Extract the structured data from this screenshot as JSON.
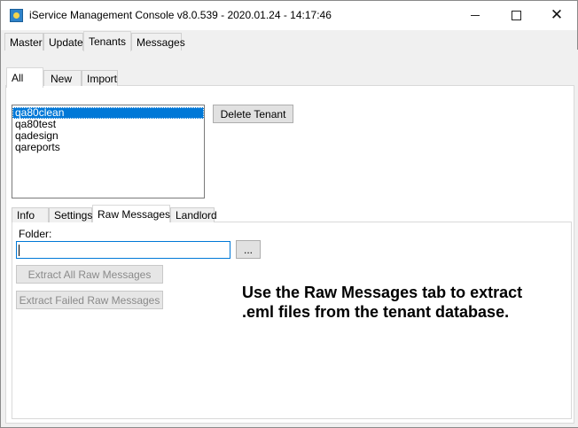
{
  "window": {
    "title": "iService Management Console v8.0.539 - 2020.01.24 - 14:17:46"
  },
  "main_tabs": [
    {
      "label": "Master"
    },
    {
      "label": "Update"
    },
    {
      "label": "Tenants"
    },
    {
      "label": "Messages"
    }
  ],
  "tenant_tabs": [
    {
      "label": "All"
    },
    {
      "label": "New"
    },
    {
      "label": "Import"
    }
  ],
  "tenants": {
    "items": [
      {
        "label": "qa80clean"
      },
      {
        "label": "qa80test"
      },
      {
        "label": "qadesign"
      },
      {
        "label": "qareports"
      }
    ],
    "selected_index": 0,
    "delete_label": "Delete Tenant"
  },
  "detail_tabs": [
    {
      "label": "Info"
    },
    {
      "label": "Settings"
    },
    {
      "label": "Raw Messages"
    },
    {
      "label": "Landlord"
    }
  ],
  "raw_messages": {
    "folder_label": "Folder:",
    "folder_value": "",
    "browse_label": "...",
    "extract_all_label": "Extract All Raw Messages",
    "extract_failed_label": "Extract Failed Raw Messages"
  },
  "annotation": {
    "text": "Use the Raw Messages tab to extract .eml files from the tenant database."
  },
  "colors": {
    "selection": "#0078d7",
    "window_bg": "#f0f0f0",
    "panel_bg": "#ffffff"
  }
}
